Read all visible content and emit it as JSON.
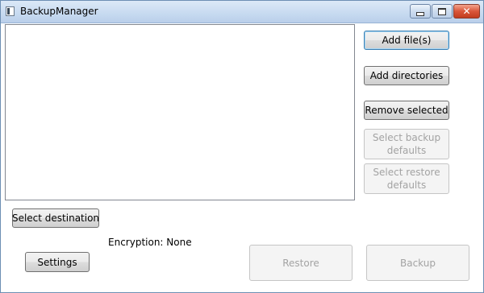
{
  "window": {
    "title": "BackupManager",
    "controls": {
      "minimize_icon": "minimize-icon",
      "maximize_icon": "maximize-icon",
      "close_glyph": "✕"
    }
  },
  "file_list": {
    "items": []
  },
  "buttons": {
    "add_files": "Add file(s)",
    "add_directories": "Add directories",
    "remove_selected": "Remove selected",
    "select_backup_defaults": "Select backup defaults",
    "select_restore_defaults": "Select restore defaults",
    "select_destination": "Select destination",
    "settings": "Settings",
    "restore": "Restore",
    "backup": "Backup"
  },
  "status": {
    "encryption": "Encryption: None"
  },
  "colors": {
    "accent_focus": "#3c7fb1",
    "close_button": "#c23c1e",
    "disabled_text": "#a3a3a3"
  }
}
